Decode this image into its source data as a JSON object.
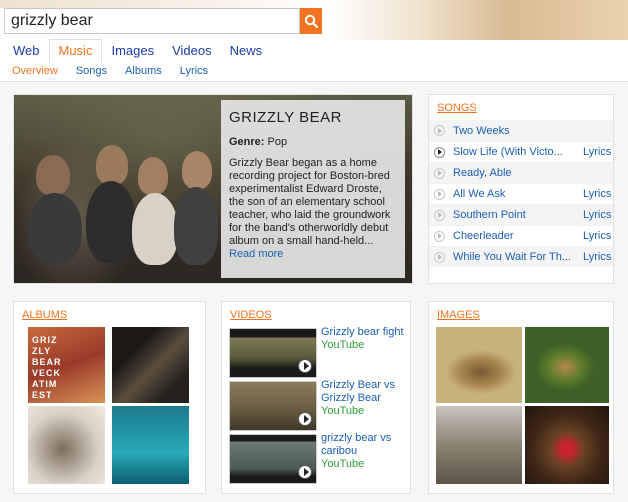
{
  "search": {
    "query": "grizzly bear"
  },
  "main_nav": [
    "Web",
    "Music",
    "Images",
    "Videos",
    "News"
  ],
  "sub_nav": [
    "Overview",
    "Songs",
    "Albums",
    "Lyrics"
  ],
  "hero": {
    "title": "GRIZZLY BEAR",
    "genre_label": "Genre:",
    "genre_value": "Pop",
    "description": "Grizzly Bear began as a home recording project for Boston-bred experimentalist Edward Droste, the son of an elementary school teacher, who laid the groundwork for the band's otherworldly debut album on a small hand-held...",
    "read_more": "Read more"
  },
  "songs": {
    "title": "SONGS",
    "items": [
      {
        "name": "Two Weeks",
        "lyrics": ""
      },
      {
        "name": "Slow Life (With Victo...",
        "lyrics": "Lyrics"
      },
      {
        "name": "Ready, Able",
        "lyrics": ""
      },
      {
        "name": "All We Ask",
        "lyrics": "Lyrics"
      },
      {
        "name": "Southern Point",
        "lyrics": "Lyrics"
      },
      {
        "name": "Cheerleader",
        "lyrics": "Lyrics"
      },
      {
        "name": "While You Wait For Th...",
        "lyrics": "Lyrics"
      }
    ]
  },
  "albums": {
    "title": "ALBUMS",
    "album1_text": "GRIZ ZLY BEAR VECK ATIM EST"
  },
  "videos": {
    "title": "VIDEOS",
    "items": [
      {
        "title": "Grizzly bear fight",
        "source": "YouTube"
      },
      {
        "title": "Grizzly Bear vs Grizzly Bear",
        "source": "YouTube"
      },
      {
        "title": "grizzly bear vs caribou",
        "source": "YouTube"
      }
    ]
  },
  "images": {
    "title": "IMAGES"
  },
  "colors": {
    "accent": "#f47320",
    "link": "#1a5fb4",
    "source": "#2e9d3a"
  }
}
